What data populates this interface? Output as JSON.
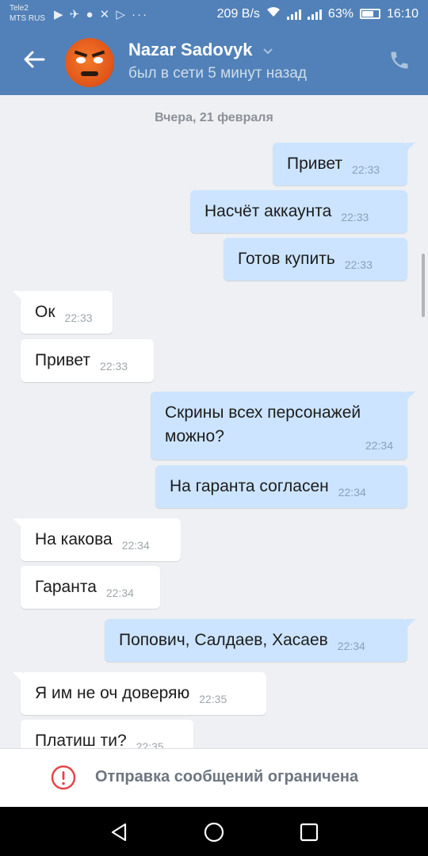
{
  "status_bar": {
    "carrier1": "Tele2",
    "carrier2": "MTS RUS",
    "net_speed": "209 B/s",
    "battery": "63%",
    "time": "16:10"
  },
  "header": {
    "name": "Nazar Sadovyk",
    "presence": "был в сети 5 минут назад"
  },
  "chat": {
    "date_label": "Вчера, 21 февраля",
    "messages": [
      {
        "dir": "out",
        "text": "Привет",
        "time": "22:33"
      },
      {
        "dir": "out",
        "text": "Насчёт аккаунта",
        "time": "22:33"
      },
      {
        "dir": "out",
        "text": "Готов купить",
        "time": "22:33"
      },
      {
        "dir": "in",
        "text": "Ок",
        "time": "22:33"
      },
      {
        "dir": "in",
        "text": "Привет",
        "time": "22:33"
      },
      {
        "dir": "out",
        "text": "Скрины всех персонажей можно?",
        "time": "22:34"
      },
      {
        "dir": "out",
        "text": "На гаранта согласен",
        "time": "22:34"
      },
      {
        "dir": "in",
        "text": "На какова",
        "time": "22:34"
      },
      {
        "dir": "in",
        "text": "Гаранта",
        "time": "22:34"
      },
      {
        "dir": "out",
        "text": "Попович, Салдаев, Хасаев",
        "time": "22:34"
      },
      {
        "dir": "in",
        "text": "Я им не оч доверяю",
        "time": "22:35"
      },
      {
        "dir": "in",
        "text": "Платиш ти?",
        "time": "22:35"
      }
    ]
  },
  "restriction": {
    "text": "Отправка сообщений ограничена"
  },
  "colors": {
    "header_bg": "#5181b8",
    "outgoing_bubble": "#cce4ff",
    "incoming_bubble": "#ffffff",
    "chat_bg": "#eef0f3",
    "warning": "#e64646"
  },
  "icons": {
    "back": "arrow-left-icon",
    "call": "phone-icon",
    "dropdown": "chevron-down-icon",
    "warning": "exclamation-circle-icon",
    "nav_back": "triangle-back-icon",
    "nav_home": "circle-home-icon",
    "nav_recent": "square-recent-icon"
  }
}
